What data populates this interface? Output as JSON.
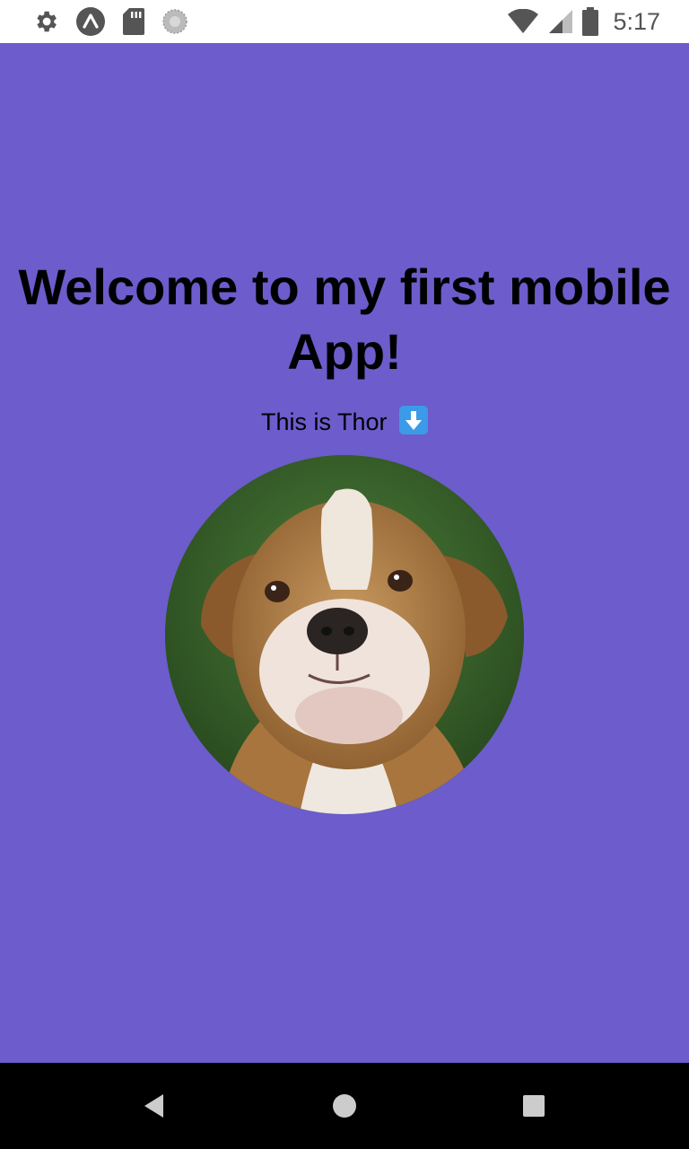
{
  "status_bar": {
    "time": "5:17",
    "icons_left": [
      "gear-icon",
      "expo-icon",
      "sd-card-icon",
      "sync-icon"
    ],
    "icons_right": [
      "wifi-icon",
      "cell-signal-icon",
      "battery-icon"
    ]
  },
  "main": {
    "title": "Welcome to my first mobile App!",
    "subtitle": "This is Thor",
    "subtitle_emoji": "down-arrow-emoji",
    "image": "bulldog-photo",
    "background_color": "#6c5ccc"
  },
  "nav_bar": {
    "buttons": [
      "back-icon",
      "home-icon",
      "recents-icon"
    ]
  }
}
